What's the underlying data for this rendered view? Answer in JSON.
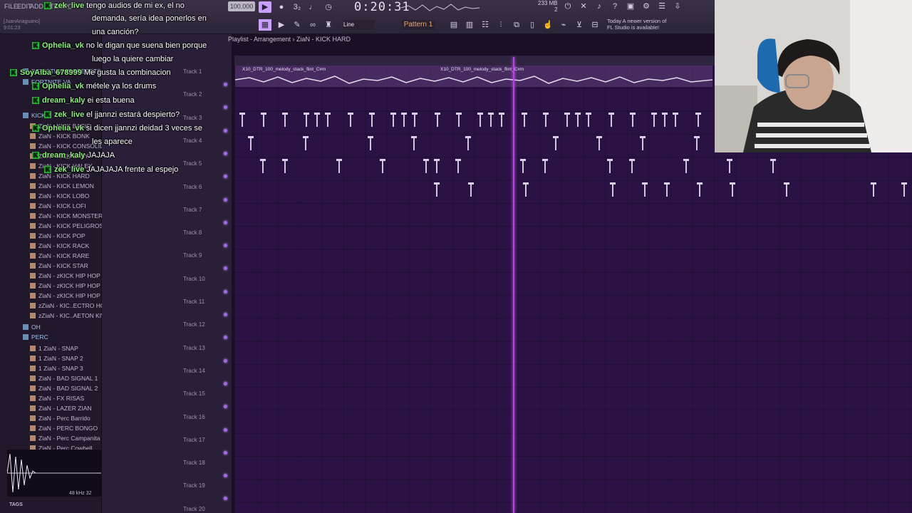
{
  "menu": [
    "FILE",
    "EDIT",
    "ADD",
    "TEMPO"
  ],
  "transport": {
    "tempo": "100.000",
    "time": "0:20:31",
    "pattern": "Pattern 1",
    "snap": "Line",
    "cpu_mb": "233 MB",
    "cpu_count": "2"
  },
  "news": {
    "line1": "Today  A newer version of",
    "line2": "FL Studio is available!"
  },
  "user_tag": {
    "name": "[JuanAnaguano]",
    "time": "9:01:23"
  },
  "playlist": {
    "title": "Playlist - Arrangement › ZiaN - KICK HARD",
    "clip_name": "X10_DTR_100_melody_stack_flint_C#m"
  },
  "tracks": [
    "Track 1",
    "Track 2",
    "Track 3",
    "Track 4",
    "Track 5",
    "Track 6",
    "Track 7",
    "Track 8",
    "Track 9",
    "Track 10",
    "Track 11",
    "Track 12",
    "Track 13",
    "Track 14",
    "Track 15",
    "Track 16",
    "Track 17",
    "Track 18",
    "Track 19",
    "Track 20"
  ],
  "browser": {
    "items": [
      {
        "label": "DIRECTWAVE PRESETS",
        "type": "folder"
      },
      {
        "label": "FORTNITE VA",
        "type": "folder"
      },
      {
        "label": "KICK",
        "type": "folder"
      },
      {
        "label": "ZiaN - KICK BASIC",
        "type": "file"
      },
      {
        "label": "ZiaN - KICK BONK",
        "type": "file"
      },
      {
        "label": "ZiaN - KICK CONSOLIDO",
        "type": "file"
      },
      {
        "label": "ZiaN - KICK EASY",
        "type": "file"
      },
      {
        "label": "ZiaN - KICK HALEY",
        "type": "file"
      },
      {
        "label": "ZiaN - KICK HARD",
        "type": "file"
      },
      {
        "label": "ZiaN - KICK LEMON",
        "type": "file"
      },
      {
        "label": "ZiaN - KICK LOBO",
        "type": "file"
      },
      {
        "label": "ZiaN - KICK LOFI",
        "type": "file"
      },
      {
        "label": "ZiaN - KICK MONSTER",
        "type": "file"
      },
      {
        "label": "ZiaN - KICK PELIGROSO",
        "type": "file"
      },
      {
        "label": "ZiaN - KICK POP",
        "type": "file"
      },
      {
        "label": "ZiaN - KICK RACK",
        "type": "file"
      },
      {
        "label": "ZiaN - KICK RARE",
        "type": "file"
      },
      {
        "label": "ZiaN - KICK STAR",
        "type": "file"
      },
      {
        "label": "ZiaN - zKICK HIP HOP 2",
        "type": "file"
      },
      {
        "label": "ZiaN - zKICK HIP HOP 3",
        "type": "file"
      },
      {
        "label": "ZiaN - zKICK HIP HOP 4",
        "type": "file"
      },
      {
        "label": "zZiaN - KIC..ECTRO HOUSE",
        "type": "file"
      },
      {
        "label": "zZiaN - KIC..AETON KIWYY",
        "type": "file"
      },
      {
        "label": "OH",
        "type": "folder"
      },
      {
        "label": "PERC",
        "type": "folder"
      },
      {
        "label": "1 ZiaN - SNAP",
        "type": "file"
      },
      {
        "label": "1 ZiaN - SNAP 2",
        "type": "file"
      },
      {
        "label": "1 ZiaN - SNAP 3",
        "type": "file"
      },
      {
        "label": "ZiaN - BAD SIGNAL 1",
        "type": "file"
      },
      {
        "label": "ZiaN - BAD SIGNAL 2",
        "type": "file"
      },
      {
        "label": "ZiaN - FX RISAS",
        "type": "file"
      },
      {
        "label": "ZiaN - LAZER ZIAN",
        "type": "file"
      },
      {
        "label": "ZiaN - Perc Barrido",
        "type": "file"
      },
      {
        "label": "ZiaN - PERC BONGO",
        "type": "file"
      },
      {
        "label": "ZiaN - Perc Campanita Tri",
        "type": "file"
      },
      {
        "label": "ZiaN - Perc Cowbell",
        "type": "file"
      }
    ],
    "scope_info": "48 kHz 32",
    "tags_label": "TAGS"
  },
  "chat": [
    {
      "user": "zek_live",
      "text": "tengo audios de mi ex, el no"
    },
    {
      "user": "",
      "text": "demanda, sería idea ponerlos en"
    },
    {
      "user": "",
      "text": "una canción?"
    },
    {
      "user": "Ophelia_vk",
      "text": "no le digan que suena bien porque"
    },
    {
      "user": "",
      "text": "luego la quiere cambiar"
    },
    {
      "user": "SoyAlba_678999",
      "text": "Me gusta la combinacion"
    },
    {
      "user": "Ophelia_vk",
      "text": "métele ya los drums"
    },
    {
      "user": "dream_kaly",
      "text": "ei esta buena"
    },
    {
      "user": "zek_live",
      "text": "el jjannzi estará despierto?"
    },
    {
      "user": "Ophelia_vk",
      "text": "si dicen jjannzi deidad 3 veces se"
    },
    {
      "user": "",
      "text": "les aparece"
    },
    {
      "user": "dream_kaly",
      "text": "JAJAJA"
    },
    {
      "user": "zek_live",
      "text": "JAJAJAJA frente al espejo"
    }
  ],
  "colors": {
    "accent": "#c13cf0",
    "playlist_bg": "#2b1244",
    "chat_user": "#8cf07c",
    "badge": "#2ec13a"
  }
}
